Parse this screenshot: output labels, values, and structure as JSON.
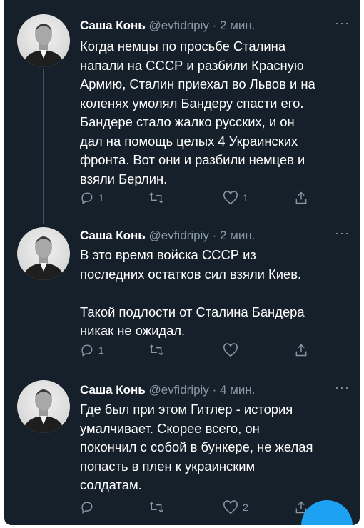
{
  "tweets": [
    {
      "name": "Саша Конь",
      "handle": "@evfidripiy",
      "dot": "·",
      "time": "2 мин.",
      "more": "···",
      "text": "Когда немцы по просьбе Сталина\nнапали на СССР и разбили Красную\nАрмию, Сталин приехал во Львов и на\nколенях умолял Бандеру спасти его.\nБандере стало жалко русских, и он\nдал на помощь целых 4 Украинских\nфронта. Вот они и разбили немцев и\nвзяли Берлин.",
      "replies": "1",
      "retweets": "",
      "likes": "1"
    },
    {
      "name": "Саша Конь",
      "handle": "@evfidripiy",
      "dot": "·",
      "time": "2 мин.",
      "more": "···",
      "text": "В это время войска СССР из\nпоследних остатков сил взяли Киев.\n\nТакой подлости от Сталина Бандера\nникак не ожидал.",
      "replies": "1",
      "retweets": "",
      "likes": ""
    },
    {
      "name": "Саша Конь",
      "handle": "@evfidripiy",
      "dot": "·",
      "time": "4 мин.",
      "more": "···",
      "text": "Где был при этом Гитлер - история\nумалчивает. Скорее всего, он\nпокончил с собой в бункере, не желая\nпопасть в плен к украинским\nсолдатам.",
      "replies": "",
      "retweets": "",
      "likes": "2"
    }
  ],
  "icons": {
    "reply": "reply-icon",
    "retweet": "retweet-icon",
    "like": "heart-icon",
    "share": "share-icon",
    "compose": "compose-fab"
  },
  "colors": {
    "background": "#15202b",
    "text": "#ffffff",
    "secondary": "#8899a6",
    "accent": "#1da1f2",
    "thread_line": "#3d5466"
  }
}
